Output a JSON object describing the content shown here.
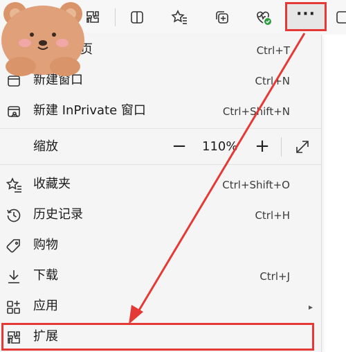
{
  "menu": {
    "new_tab": {
      "label_visible": "页",
      "shortcut": "Ctrl+T"
    },
    "new_window": {
      "label": "新建窗口",
      "shortcut": "Ctrl+N"
    },
    "new_inprivate": {
      "label": "新建 InPrivate 窗口",
      "shortcut": "Ctrl+Shift+N"
    },
    "zoom": {
      "label": "缩放",
      "minus": "−",
      "value": "110%",
      "plus": "+"
    },
    "favorites": {
      "label": "收藏夹",
      "shortcut": "Ctrl+Shift+O"
    },
    "history": {
      "label": "历史记录",
      "shortcut": "Ctrl+H"
    },
    "shopping": {
      "label": "购物"
    },
    "downloads": {
      "label": "下载",
      "shortcut": "Ctrl+J"
    },
    "apps": {
      "label": "应用",
      "arrow": "▸"
    },
    "extensions": {
      "label": "扩展"
    }
  },
  "toolbar": {
    "more_label": "···"
  },
  "colors": {
    "highlight": "#e53935",
    "health_badge": "#2e9d3f"
  }
}
